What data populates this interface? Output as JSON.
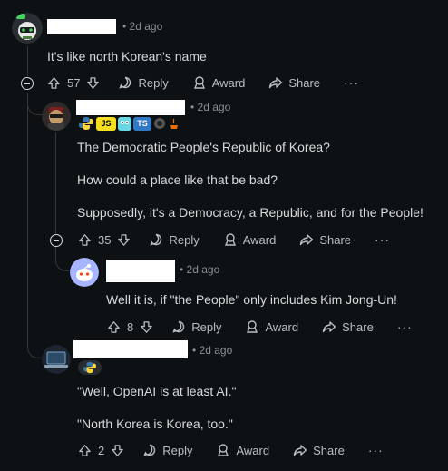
{
  "comments": [
    {
      "time": "2d ago",
      "text": [
        "It's like north Korean's name"
      ],
      "votes": "57"
    },
    {
      "time": "2d ago",
      "text": [
        "The Democratic People's Republic of Korea?",
        "How could a place like that be bad?",
        "Supposedly, it's a Democracy, a Republic, and for the People!"
      ],
      "votes": "35",
      "flair_badges": [
        "JS",
        "TS"
      ]
    },
    {
      "time": "2d ago",
      "text": [
        "Well it is, if \"the People\" only includes Kim Jong-Un!"
      ],
      "votes": "8"
    },
    {
      "time": "2d ago",
      "text": [
        "\"Well, OpenAI is at least AI.\"",
        "\"North Korea is Korea, too.\""
      ],
      "votes": "2"
    }
  ],
  "labels": {
    "reply": "Reply",
    "award": "Award",
    "share": "Share",
    "more": "···",
    "separator": "•"
  },
  "colors": {
    "background": "#0e1113",
    "text": "#d7dadc",
    "meta": "#8a9197",
    "thread_line": "#33383d"
  },
  "icons": [
    "upvote-icon",
    "downvote-icon",
    "reply-icon",
    "award-icon",
    "share-icon",
    "collapse-icon"
  ]
}
